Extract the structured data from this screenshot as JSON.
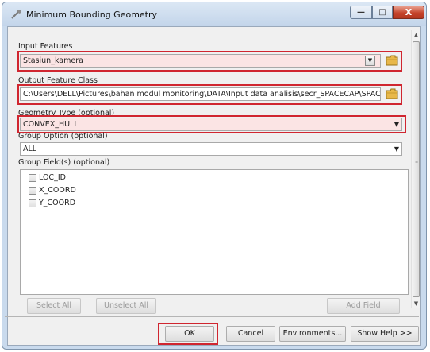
{
  "window": {
    "title": "Minimum Bounding Geometry",
    "controls": {
      "minimize": "—",
      "maximize": "□",
      "close": "X"
    }
  },
  "form": {
    "input_features": {
      "label": "Input Features",
      "value": "Stasiun_kamera"
    },
    "output_class": {
      "label": "Output Feature Class",
      "value": "C:\\Users\\DELL\\Pictures\\bahan modul monitoring\\DATA\\Input data analisis\\secr_SPACECAP\\SPACE"
    },
    "geometry_type": {
      "label": "Geometry Type (optional)",
      "value": "CONVEX_HULL"
    },
    "group_option": {
      "label": "Group Option (optional)",
      "value": "ALL"
    },
    "group_fields": {
      "label": "Group Field(s) (optional)",
      "items": [
        "LOC_ID",
        "X_COORD",
        "Y_COORD"
      ]
    },
    "select_all": "Select All",
    "unselect_all": "Unselect All",
    "add_field": "Add Field"
  },
  "footer": {
    "ok": "OK",
    "cancel": "Cancel",
    "environments": "Environments...",
    "show_help": "Show Help >>"
  },
  "colors": {
    "highlight": "#d02630",
    "input_bg": "#fbe4e4"
  },
  "icons": [
    "hammer-icon",
    "folder-icon",
    "dropdown-arrow-icon"
  ]
}
